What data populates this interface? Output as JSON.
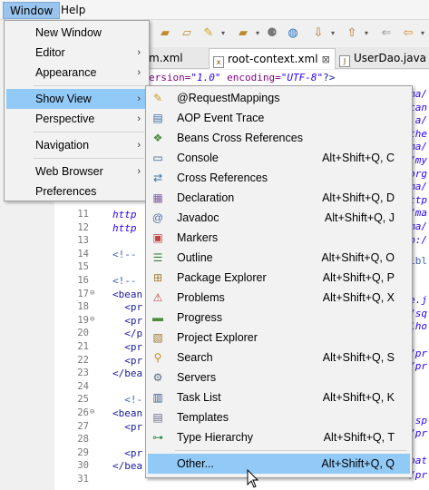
{
  "menubar": {
    "window": "Window",
    "help": "Help"
  },
  "toolbar": {
    "icons": [
      "folder-icon",
      "folder-open-icon",
      "pen-icon",
      "folder-icon",
      "run-icon",
      "globe-icon",
      "down-arrow-icon",
      "up-arrow-icon",
      "back-icon"
    ]
  },
  "tabs": [
    {
      "label": "m.xml"
    },
    {
      "label": "root-context.xml",
      "close": "⊠"
    },
    {
      "label": "UserDao.java"
    }
  ],
  "editor": {
    "line1": {
      "attr": "ersion=",
      "val": "\"1.0\"",
      "attr2": " encoding=",
      "val2": "\"UTF-8\"",
      "end": "?>"
    },
    "right_fragments": [
      "ma/",
      "tan",
      "a/",
      "the",
      "ma/",
      "/my",
      "org",
      "ma/",
      "ttp",
      "/ma",
      "ma/",
      "p:/"
    ],
    "lines": [
      {
        "n": "11",
        "code": "http",
        "fold": ""
      },
      {
        "n": "12",
        "code": "http",
        "fold": ""
      },
      {
        "n": "13",
        "code": "",
        "fold": ""
      },
      {
        "n": "14",
        "code": "<!-- ",
        "fold": ""
      },
      {
        "n": "15",
        "code": "",
        "fold": ""
      },
      {
        "n": "16",
        "code": "<!-- ",
        "fold": ""
      },
      {
        "n": "17",
        "code": "<bean",
        "fold": "⊖"
      },
      {
        "n": "18",
        "code": "  <pr",
        "fold": ""
      },
      {
        "n": "19",
        "code": "  <pr",
        "fold": "⊖"
      },
      {
        "n": "20",
        "code": "  </p",
        "fold": ""
      },
      {
        "n": "21",
        "code": "  <pr",
        "fold": ""
      },
      {
        "n": "22",
        "code": "  <pr",
        "fold": ""
      },
      {
        "n": "23",
        "code": "</bea",
        "fold": ""
      },
      {
        "n": "24",
        "code": "",
        "fold": ""
      },
      {
        "n": "25",
        "code": "  <!-",
        "fold": ""
      },
      {
        "n": "26",
        "code": "<bean",
        "fold": "⊖"
      },
      {
        "n": "27",
        "code": "  <pr",
        "fold": ""
      },
      {
        "n": "28",
        "code": "",
        "fold": ""
      },
      {
        "n": "29",
        "code": "  <pr",
        "fold": ""
      },
      {
        "n": "30",
        "code": "</bea",
        "fold": ""
      },
      {
        "n": "31",
        "code": "",
        "fold": ""
      }
    ],
    "right_code": [
      "ibl",
      "e.j",
      "/sq",
      "lho",
      "/pr",
      "/pr",
      ".sp",
      "/pr",
      "oat",
      "/pr"
    ]
  },
  "window_menu": {
    "items": [
      {
        "label": "New Window",
        "arrow": ""
      },
      {
        "label": "Editor",
        "arrow": "›"
      },
      {
        "label": "Appearance",
        "arrow": "›"
      },
      {
        "label": "Show View",
        "arrow": "›"
      },
      {
        "label": "Perspective",
        "arrow": "›"
      },
      {
        "label": "Navigation",
        "arrow": "›"
      },
      {
        "label": "Web Browser",
        "arrow": "›"
      },
      {
        "label": "Preferences",
        "arrow": ""
      }
    ]
  },
  "show_view": {
    "items": [
      {
        "label": "@RequestMappings",
        "shortcut": "",
        "icon": "request-mappings-icon",
        "glyph": "✎"
      },
      {
        "label": "AOP Event Trace",
        "shortcut": "",
        "icon": "aop-trace-icon",
        "glyph": "▤"
      },
      {
        "label": "Beans Cross References",
        "shortcut": "",
        "icon": "beans-icon",
        "glyph": "❖"
      },
      {
        "label": "Console",
        "shortcut": "Alt+Shift+Q, C",
        "icon": "console-icon",
        "glyph": "▭"
      },
      {
        "label": "Cross References",
        "shortcut": "",
        "icon": "cross-references-icon",
        "glyph": "⇄"
      },
      {
        "label": "Declaration",
        "shortcut": "Alt+Shift+Q, D",
        "icon": "declaration-icon",
        "glyph": "▦"
      },
      {
        "label": "Javadoc",
        "shortcut": "Alt+Shift+Q, J",
        "icon": "javadoc-icon",
        "glyph": "@"
      },
      {
        "label": "Markers",
        "shortcut": "",
        "icon": "markers-icon",
        "glyph": "▣"
      },
      {
        "label": "Outline",
        "shortcut": "Alt+Shift+Q, O",
        "icon": "outline-icon",
        "glyph": "☰"
      },
      {
        "label": "Package Explorer",
        "shortcut": "Alt+Shift+Q, P",
        "icon": "package-explorer-icon",
        "glyph": "⊞"
      },
      {
        "label": "Problems",
        "shortcut": "Alt+Shift+Q, X",
        "icon": "problems-icon",
        "glyph": "⚠"
      },
      {
        "label": "Progress",
        "shortcut": "",
        "icon": "progress-icon",
        "glyph": "▬"
      },
      {
        "label": "Project Explorer",
        "shortcut": "",
        "icon": "project-explorer-icon",
        "glyph": "▧"
      },
      {
        "label": "Search",
        "shortcut": "Alt+Shift+Q, S",
        "icon": "search-icon",
        "glyph": "⚲"
      },
      {
        "label": "Servers",
        "shortcut": "",
        "icon": "servers-icon",
        "glyph": "⚙"
      },
      {
        "label": "Task List",
        "shortcut": "Alt+Shift+Q, K",
        "icon": "task-list-icon",
        "glyph": "▥"
      },
      {
        "label": "Templates",
        "shortcut": "",
        "icon": "templates-icon",
        "glyph": "▤"
      },
      {
        "label": "Type Hierarchy",
        "shortcut": "Alt+Shift+Q, T",
        "icon": "type-hierarchy-icon",
        "glyph": "⊶"
      },
      {
        "label": "Other...",
        "shortcut": "Alt+Shift+Q, Q",
        "icon": "",
        "glyph": ""
      }
    ]
  }
}
